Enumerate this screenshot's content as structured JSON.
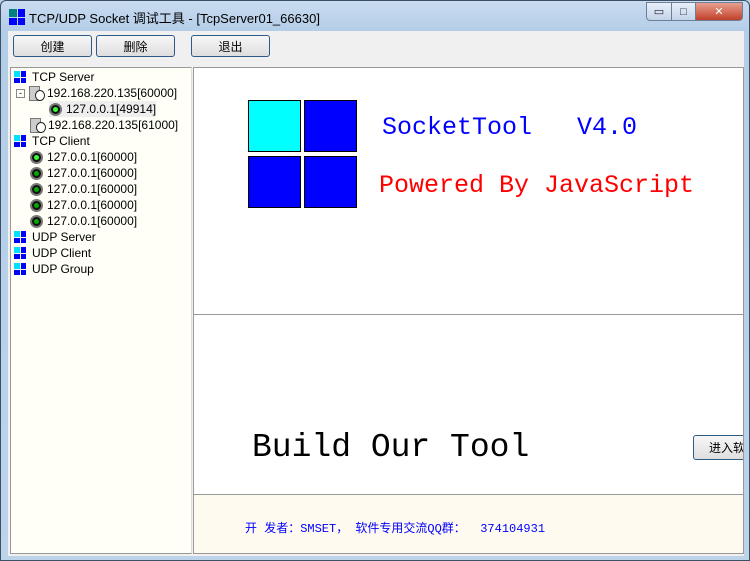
{
  "window": {
    "title": "TCP/UDP Socket 调试工具 - [TcpServer01_66630]",
    "minimize": "▭",
    "maximize": "□",
    "close": "✕"
  },
  "toolbar": {
    "create": "创建",
    "delete": "删除",
    "exit": "退出"
  },
  "tree": {
    "tcp_server": "TCP Server",
    "servers": [
      {
        "label": "192.168.220.135[60000]",
        "children": [
          "127.0.0.1[49914]"
        ]
      },
      {
        "label": "192.168.220.135[61000]"
      }
    ],
    "tcp_client": "TCP Client",
    "clients": [
      "127.0.0.1[60000]",
      "127.0.0.1[60000]",
      "127.0.0.1[60000]",
      "127.0.0.1[60000]",
      "127.0.0.1[60000]"
    ],
    "udp_server": "UDP Server",
    "udp_client": "UDP Client",
    "udp_group": "UDP Group"
  },
  "main": {
    "app_name": "SocketTool   V4.0",
    "powered": "Powered By JavaScript",
    "slogan": "Build Our Tool",
    "enter_button": "进入软件",
    "footer": "开 发者：SMSET， 软件专用交流QQ群：  374104931"
  },
  "colors": {
    "blue": "#0000ff",
    "red": "#ff0000",
    "cyan": "#00ffff"
  }
}
